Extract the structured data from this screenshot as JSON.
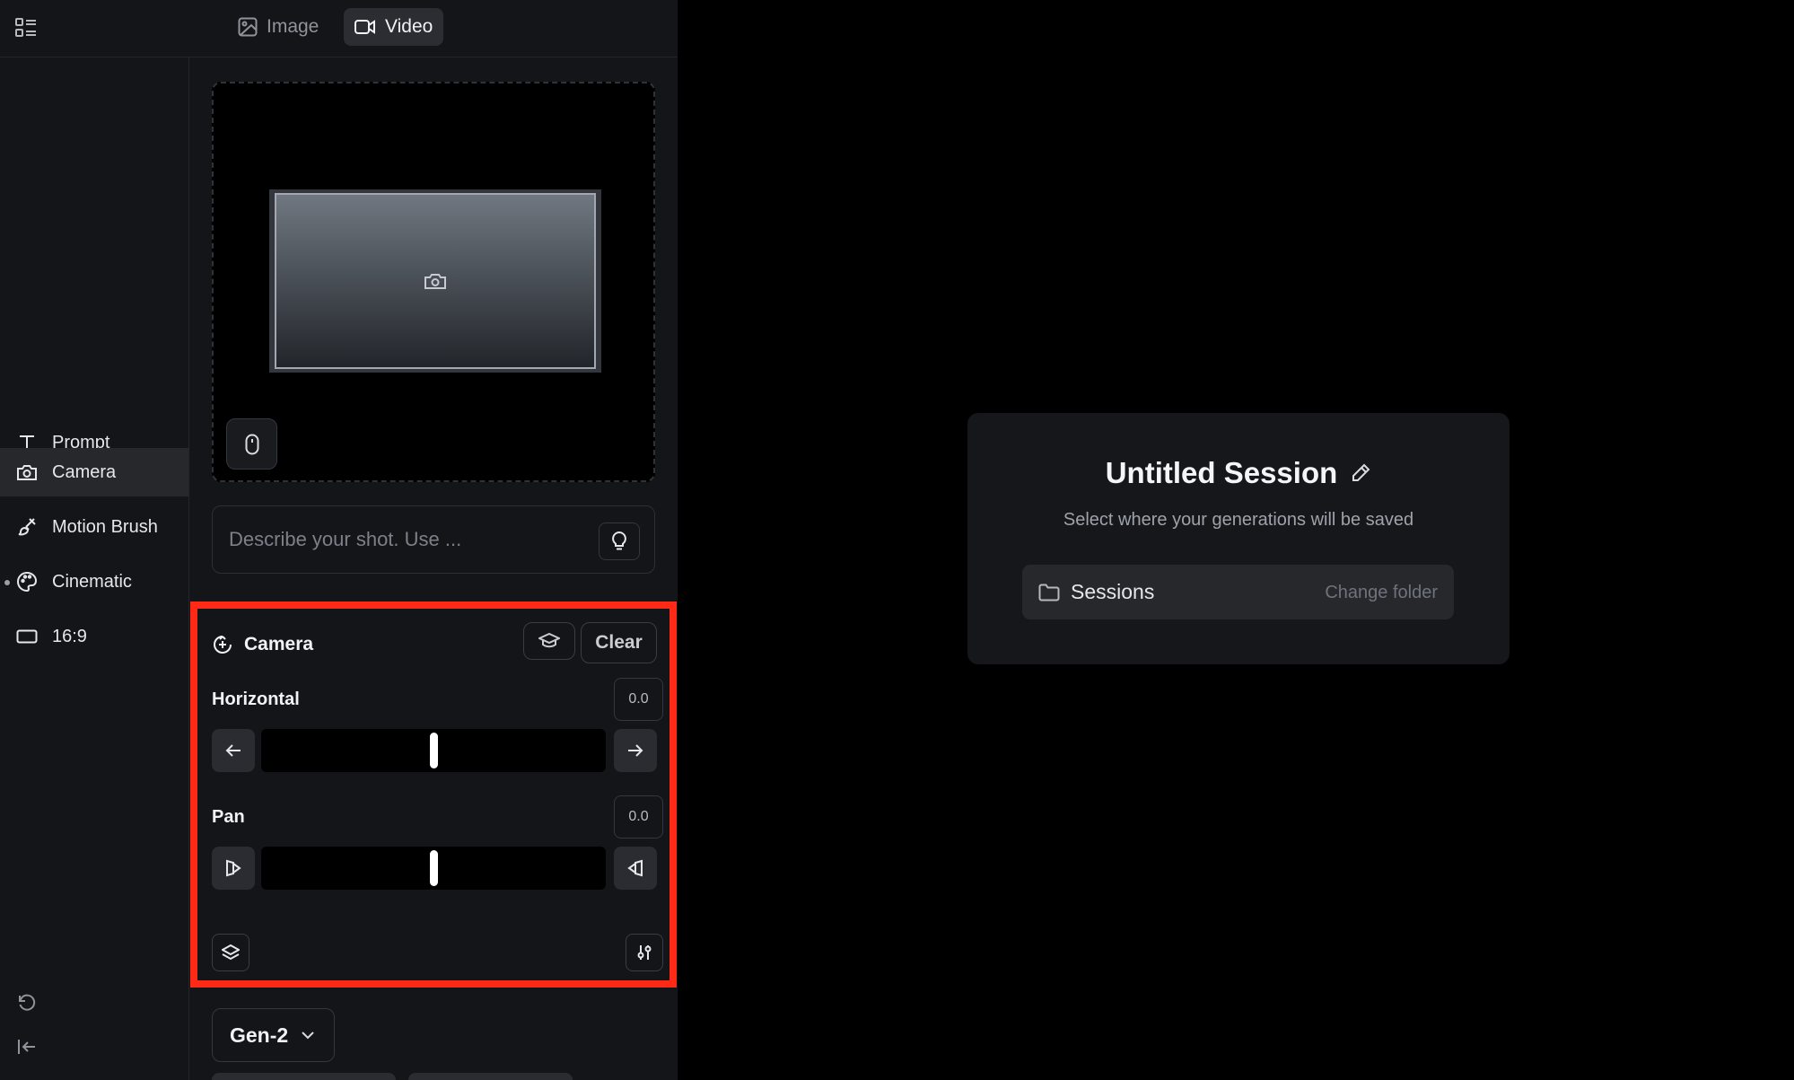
{
  "mode_tabs": [
    {
      "label": "Image",
      "icon": "image-icon",
      "active": false
    },
    {
      "label": "Video",
      "icon": "video-icon",
      "active": true
    }
  ],
  "sidebar": {
    "items": [
      {
        "label": "Prompt",
        "icon": "text-icon"
      },
      {
        "label": "Camera",
        "icon": "camera-icon",
        "active": true
      },
      {
        "label": "Motion Brush",
        "icon": "brush-icon"
      },
      {
        "label": "Cinematic",
        "icon": "palette-icon"
      },
      {
        "label": "16:9",
        "icon": "aspect-ratio-icon"
      }
    ],
    "bottom_icons": [
      "undo-icon",
      "collapse-icon"
    ]
  },
  "prompt": {
    "placeholder": "Describe your shot. Use ..."
  },
  "camera_panel": {
    "title": "Camera",
    "clear_label": "Clear",
    "controls": [
      {
        "label": "Horizontal",
        "value": "0.0",
        "min": -10,
        "max": 10
      },
      {
        "label": "Pan",
        "value": "0.0",
        "min": -10,
        "max": 10
      }
    ]
  },
  "model_select": {
    "value": "Gen-2"
  },
  "session": {
    "title": "Untitled Session",
    "subtitle": "Select where your generations will be saved",
    "folder": "Sessions",
    "change_folder_label": "Change folder"
  },
  "colors": {
    "highlight": "#ff2a16",
    "panel_bg": "#141518",
    "card_bg": "#16171a"
  }
}
